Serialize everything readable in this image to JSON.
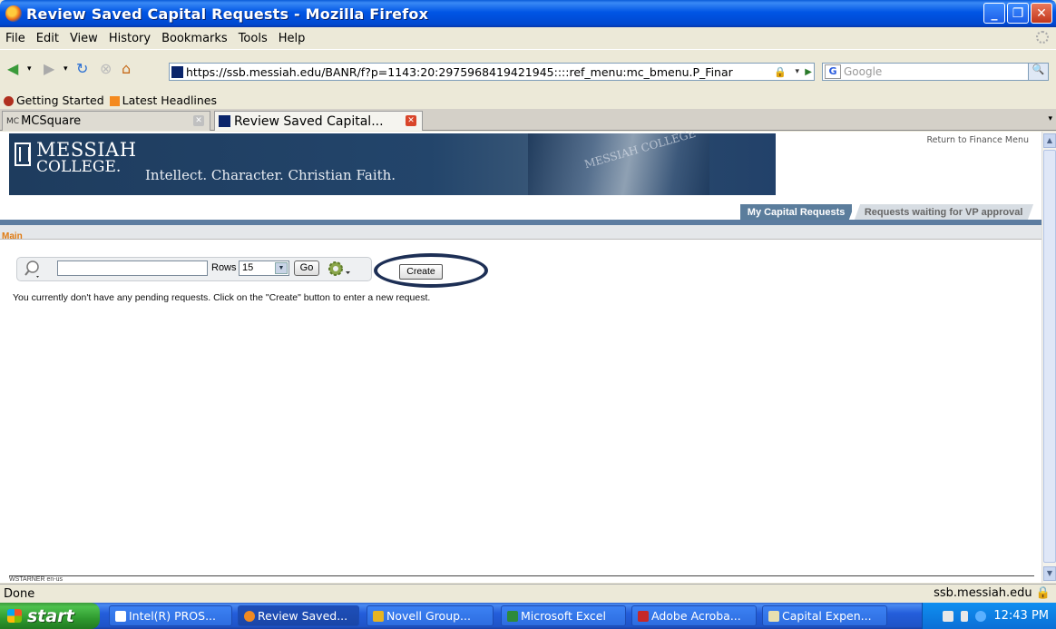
{
  "window": {
    "title": "Review Saved Capital Requests - Mozilla Firefox",
    "controls": [
      "minimize",
      "maximize",
      "close"
    ]
  },
  "menubar": {
    "items": [
      "File",
      "Edit",
      "View",
      "History",
      "Bookmarks",
      "Tools",
      "Help"
    ]
  },
  "navbar": {
    "url": "https://ssb.messiah.edu/BANR/f?p=1143:20:2975968419421945::::ref_menu:mc_bmenu.P_Finar",
    "search_placeholder": "Google"
  },
  "bookmarks": [
    "Getting Started",
    "Latest Headlines"
  ],
  "tabs": [
    {
      "label": "MCSquare",
      "active": false
    },
    {
      "label": "Review Saved Capital...",
      "active": true
    }
  ],
  "page": {
    "logo_line1": "MESSIAH",
    "logo_line2": "COLLEGE.",
    "tagline": "Intellect. Character. Christian Faith.",
    "photo_text": "MESSIAH COLLEGE",
    "return_link": "Return to Finance Menu",
    "app_tabs": [
      "My Capital Requests",
      "Requests waiting for VP approval"
    ],
    "breadcrumb": "Main",
    "rows_label": "Rows",
    "rows_value": "15",
    "go_label": "Go",
    "create_label": "Create",
    "message": "You currently don't have any pending requests. Click on the \"Create\" button to enter a new request.",
    "footer_user": "WSTARNER   en-us"
  },
  "status": {
    "text": "Done",
    "host": "ssb.messiah.edu"
  },
  "taskbar": {
    "start": "start",
    "tasks": [
      "Intel(R) PROS...",
      "Review Saved...",
      "Novell Group...",
      "Microsoft Excel",
      "Adobe Acroba...",
      "Capital Expen..."
    ],
    "clock": "12:43 PM"
  },
  "colors": {
    "banner": "#23456b",
    "accent_orange": "#e07a10",
    "tab_on": "#5b7d9c",
    "circle_mark": "#1d2f55"
  }
}
